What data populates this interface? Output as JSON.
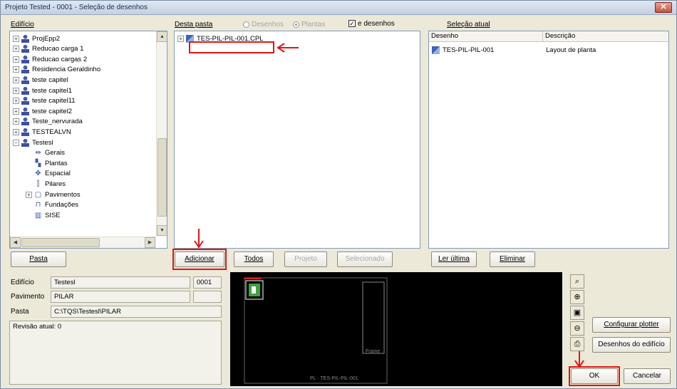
{
  "window": {
    "title": "Projeto Tested - 0001 - Seleção de desenhos",
    "close": "✕"
  },
  "edificio_label": "Edifício",
  "tree": [
    {
      "label": "ProjEpp2",
      "expand": "+"
    },
    {
      "label": "Reducao carga 1",
      "expand": "+"
    },
    {
      "label": "Reducao cargas 2",
      "expand": "+"
    },
    {
      "label": "Residencia Geraldinho",
      "expand": "+"
    },
    {
      "label": "teste capitel",
      "expand": "+"
    },
    {
      "label": "teste capitel1",
      "expand": "+"
    },
    {
      "label": "teste capitel11",
      "expand": "+"
    },
    {
      "label": "teste capitel2",
      "expand": "+"
    },
    {
      "label": "Teste_nervurada",
      "expand": "+"
    },
    {
      "label": "TESTEALVN",
      "expand": "+"
    },
    {
      "label": "Testesl",
      "expand": "−"
    }
  ],
  "subtree": [
    {
      "label": "Gerais",
      "icon": "ruler-icon"
    },
    {
      "label": "Plantas",
      "icon": "plan-icon"
    },
    {
      "label": "Espacial",
      "icon": "spatial-icon"
    },
    {
      "label": "Pilares",
      "icon": "pillar-icon"
    },
    {
      "label": "Pavimentos",
      "icon": "floors-icon",
      "expand": "+"
    },
    {
      "label": "Fundações",
      "icon": "foundation-icon"
    },
    {
      "label": "SISE",
      "icon": "sise-icon"
    }
  ],
  "pasta_button": "Pasta",
  "desta_pasta_label": "Desta pasta",
  "filters": {
    "desenhos": "Desenhos",
    "plantas": "Plantas",
    "e_desenhos": "e desenhos"
  },
  "file_list": [
    {
      "label": "TES-PIL-PIL-001.CPL",
      "expand": "+"
    }
  ],
  "buttons": {
    "adicionar": "Adicionar",
    "todos": "Todos",
    "projeto": "Projeto",
    "selecionado": "Selecionado",
    "ler_ultima": "Ler última",
    "eliminar": "Eliminar"
  },
  "selecao_atual": {
    "label": "Seleção atual",
    "columns": [
      "Desenho",
      "Descrição"
    ],
    "rows": [
      {
        "desenho": "TES-PIL-PIL-001",
        "descricao": "Layout de planta"
      }
    ]
  },
  "info": {
    "edificio_label": "Edifício",
    "edificio_value": "Testesl",
    "code_value": "0001",
    "pavimento_label": "Pavimento",
    "pavimento_value": "PILAR",
    "pasta_label": "Pasta",
    "pasta_value": "C:\\TQS\\Testesl\\PILAR",
    "revisao": "Revisão atual: 0"
  },
  "preview": {
    "caption": "PL · TES-PIL-PIL-001",
    "frame_text": "Frame"
  },
  "tools": [
    "zoom-fit-icon",
    "zoom-in-icon",
    "zoom-window-icon",
    "zoom-out-icon",
    "print-icon"
  ],
  "right_buttons": {
    "configurar": "Configurar plotter",
    "desenhos_edificio": "Desenhos do edifício",
    "ok": "OK",
    "cancelar": "Cancelar"
  },
  "colors": {
    "accent_red": "#e01515",
    "preview_bg": "#000000",
    "drawing_green": "#3ea23e"
  }
}
